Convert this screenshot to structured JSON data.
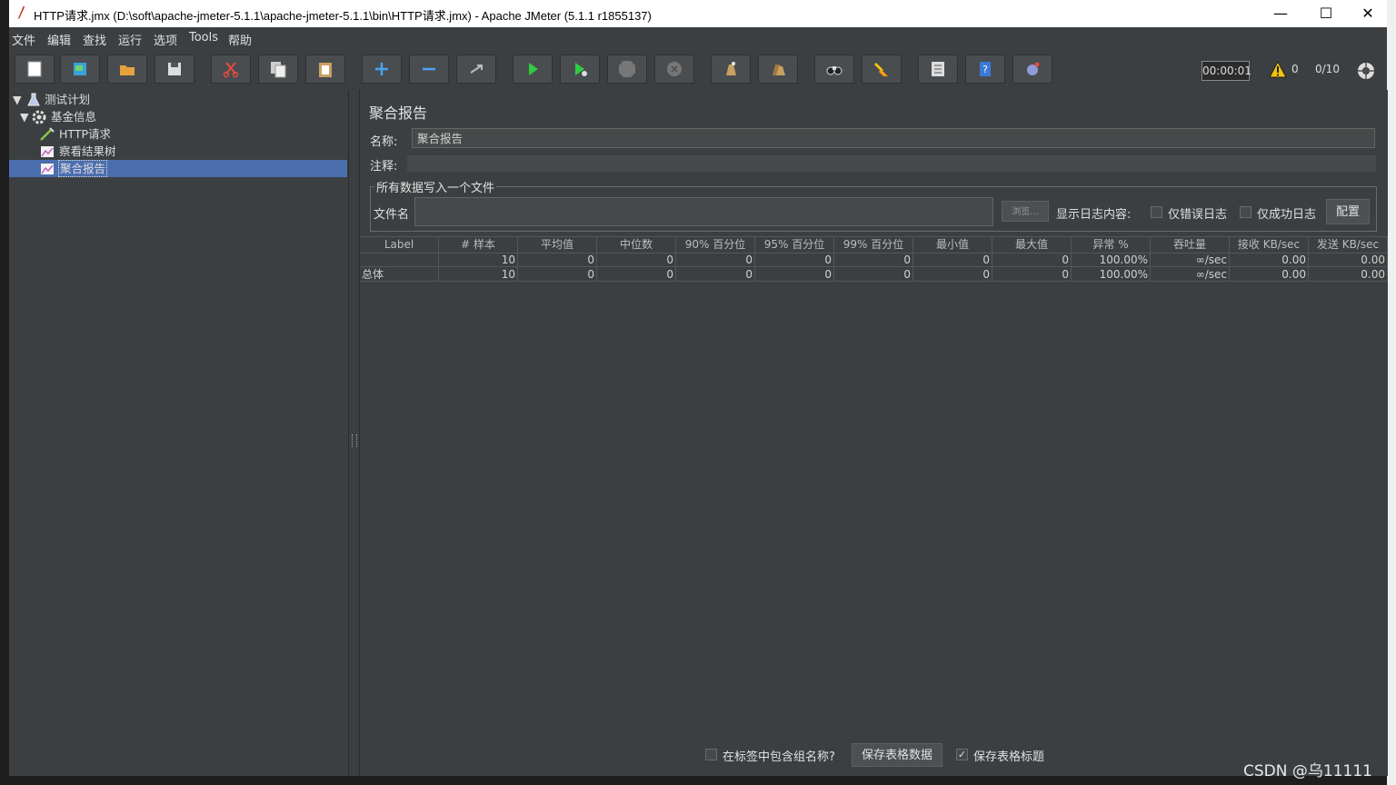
{
  "window": {
    "title": "HTTP请求.jmx (D:\\soft\\apache-jmeter-5.1.1\\apache-jmeter-5.1.1\\bin\\HTTP请求.jmx) - Apache JMeter (5.1.1 r1855137)",
    "minimize": "—",
    "maximize": "☐",
    "close": "✕"
  },
  "menu": [
    "文件",
    "编辑",
    "查找",
    "运行",
    "选项",
    "Tools",
    "帮助"
  ],
  "toolbar": {
    "icons": [
      "new-icon",
      "templates-icon",
      "open-icon",
      "save-icon",
      "cut-icon",
      "copy-icon",
      "paste-icon",
      "expand-icon",
      "collapse-icon",
      "toggle-icon",
      "start-icon",
      "start-no-pause-icon",
      "stop-icon",
      "shutdown-icon",
      "clear-icon",
      "clear-all-icon",
      "search-icon",
      "reset-search-icon",
      "function-helper-icon",
      "help-icon",
      "remote-icon"
    ],
    "timer": "00:00:01",
    "warning_count": "0",
    "threads": "0/10"
  },
  "tree": {
    "items": [
      {
        "label": "测试计划",
        "level": 0,
        "icon": "test-plan-icon"
      },
      {
        "label": "基金信息",
        "level": 1,
        "icon": "thread-group-icon"
      },
      {
        "label": "HTTP请求",
        "level": 2,
        "icon": "sampler-icon"
      },
      {
        "label": "察看结果树",
        "level": 2,
        "icon": "listener-icon"
      },
      {
        "label": "聚合报告",
        "level": 2,
        "icon": "listener-icon",
        "selected": true
      }
    ]
  },
  "panel": {
    "title": "聚合报告",
    "name_label": "名称:",
    "name_value": "聚合报告",
    "comment_label": "注释:",
    "file_section_title": "所有数据写入一个文件",
    "file_label": "文件名",
    "browse_label": "浏览...",
    "log_content_label": "显示日志内容:",
    "errors_only_label": "仅错误日志",
    "success_only_label": "仅成功日志",
    "config_label": "配置"
  },
  "table": {
    "headers": [
      "Label",
      "# 样本",
      "平均值",
      "中位数",
      "90% 百分位",
      "95% 百分位",
      "99% 百分位",
      "最小值",
      "最大值",
      "异常 %",
      "吞吐量",
      "接收 KB/sec",
      "发送 KB/sec"
    ],
    "rows": [
      [
        "",
        "10",
        "0",
        "0",
        "0",
        "0",
        "0",
        "0",
        "0",
        "100.00%",
        "∞/sec",
        "0.00",
        "0.00"
      ],
      [
        "总体",
        "10",
        "0",
        "0",
        "0",
        "0",
        "0",
        "0",
        "0",
        "100.00%",
        "∞/sec",
        "0.00",
        "0.00"
      ]
    ]
  },
  "footer": {
    "include_group_label": "在标签中包含组名称?",
    "save_table_label": "保存表格数据",
    "save_header_label": "保存表格标题",
    "save_header_checked": true
  },
  "watermark": "CSDN @乌11111"
}
